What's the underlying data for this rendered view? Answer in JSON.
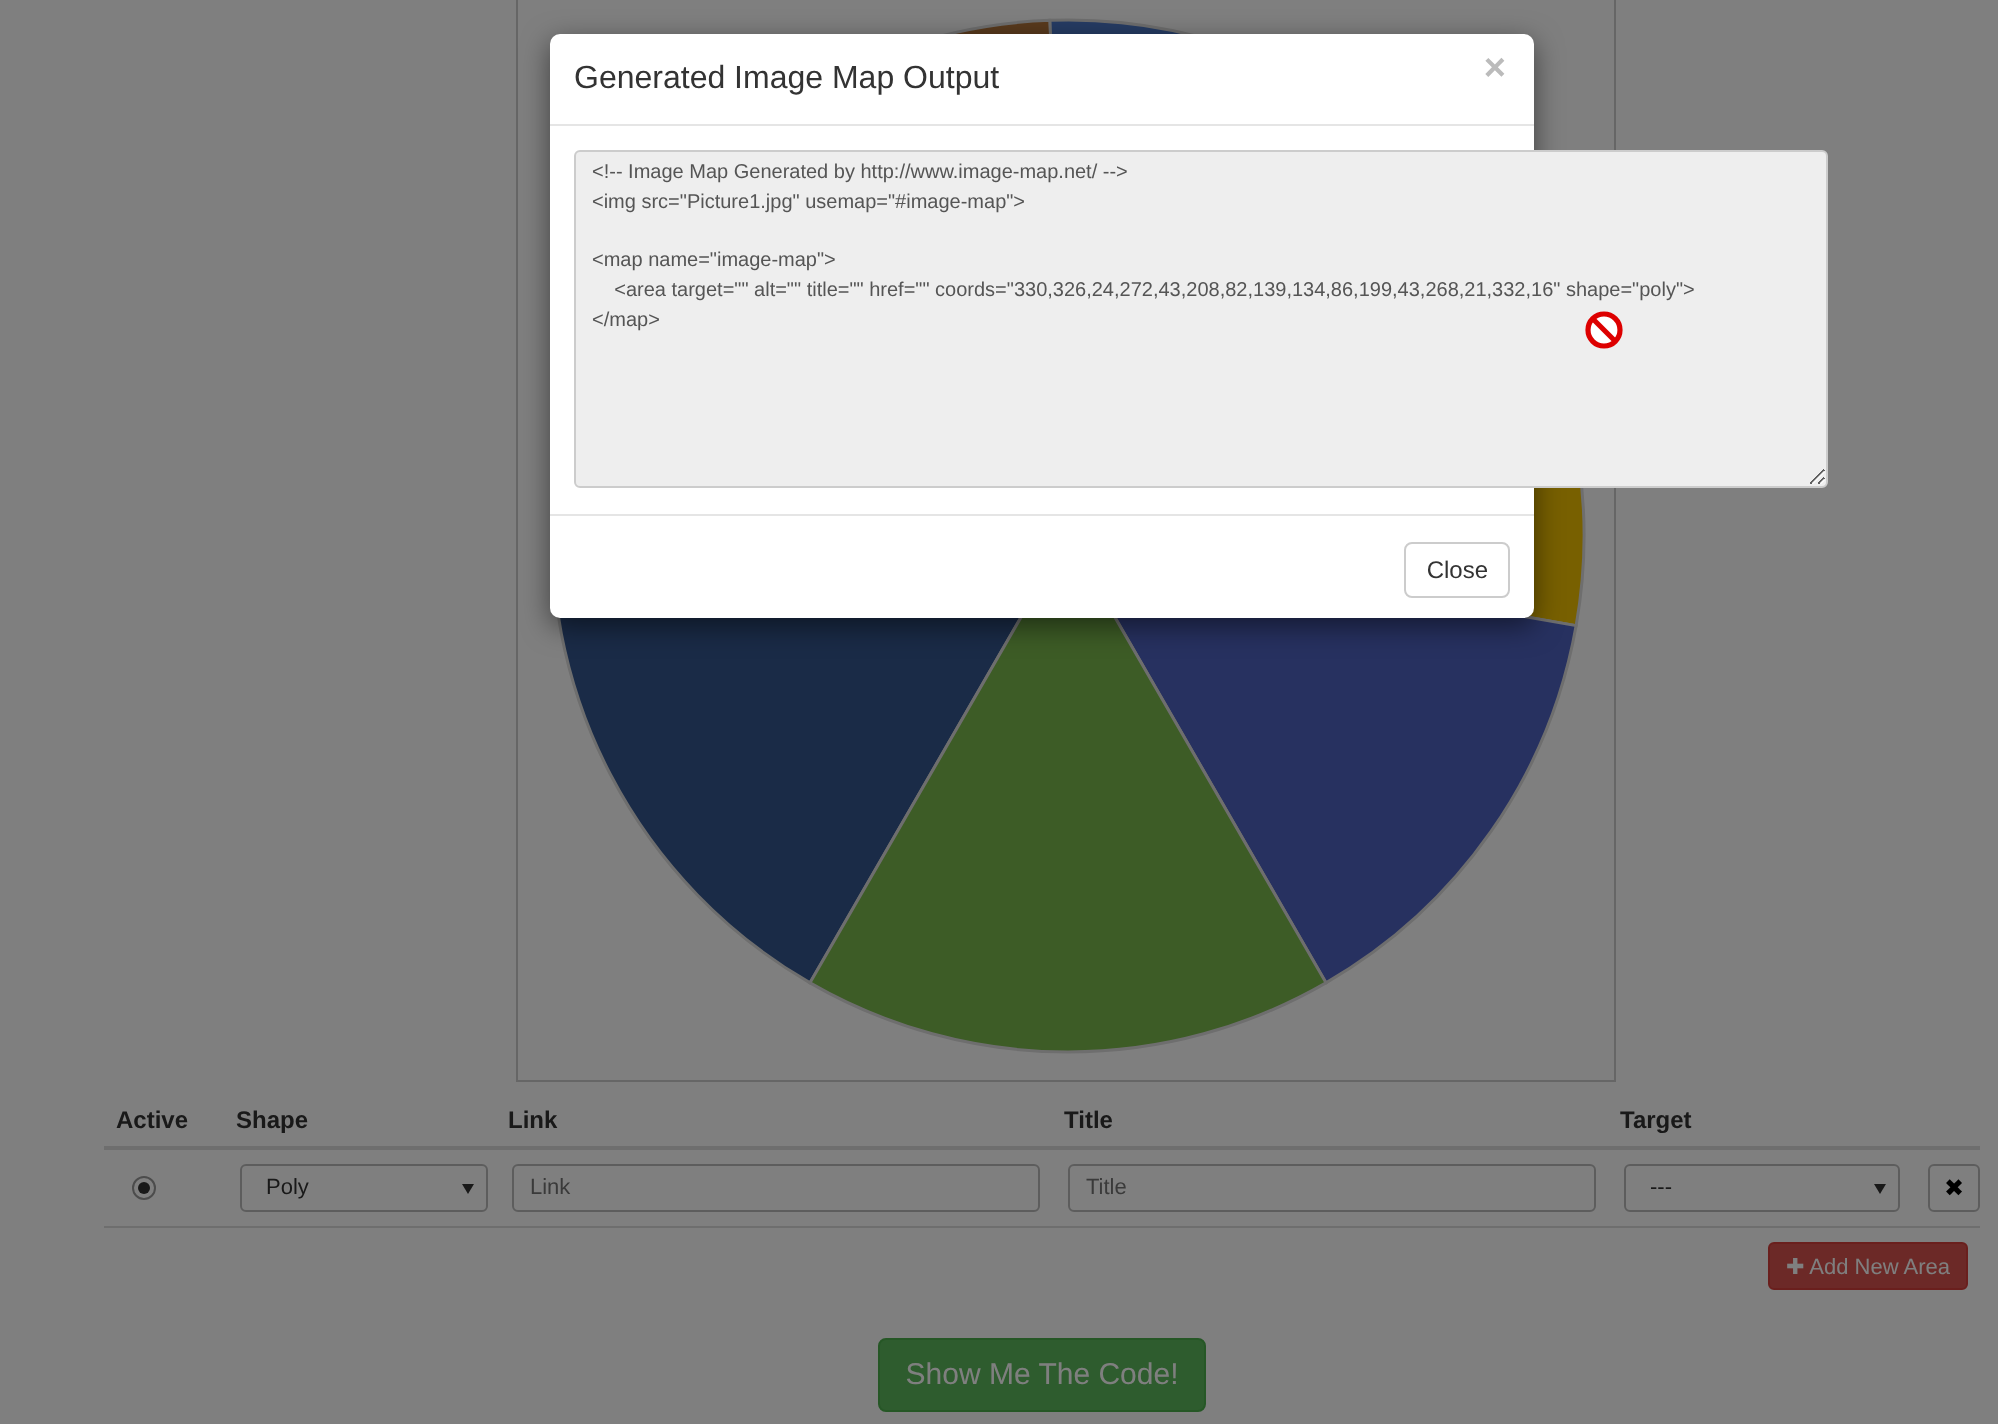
{
  "editor": {
    "columns": [
      "Active",
      "Shape",
      "Link",
      "Title",
      "Target"
    ],
    "areas": [
      {
        "selected": true,
        "shape": "Poly",
        "link_placeholder": "Link",
        "title_placeholder": "Title",
        "target": "---",
        "delete_icon": "✖"
      }
    ],
    "add_button": {
      "icon": "✚",
      "label": "Add New Area"
    },
    "show_code_button": "Show Me The Code!"
  },
  "modal": {
    "title": "Generated Image Map Output",
    "close_icon": "×",
    "code_blocks": [
      [
        "<!-- Image Map Generated by http://www.image-map.net/ -->",
        "<img src=\"Picture1.jpg\" usemap=\"#image-map\">"
      ],
      [
        "<map name=\"image-map\">",
        "    <area target=\"\" alt=\"\" title=\"\" href=\"\" coords=\"330,326,24,272,43,208,82,139,134,86,199,43,268,21,332,16\" shape=\"poly\">",
        "</map>"
      ]
    ],
    "close_button": "Close"
  }
}
